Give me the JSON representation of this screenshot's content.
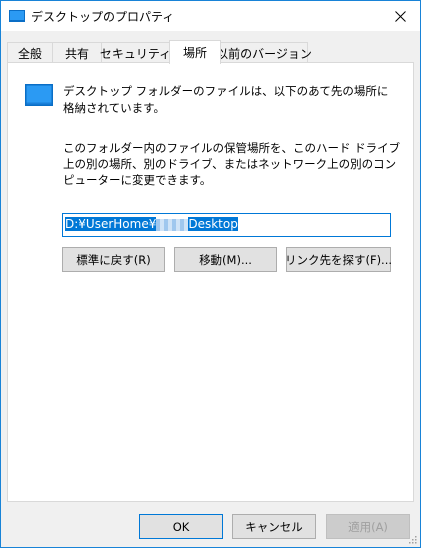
{
  "window": {
    "title": "デスクトップのプロパティ"
  },
  "tabs": [
    {
      "label": "全般",
      "active": false
    },
    {
      "label": "共有",
      "active": false
    },
    {
      "label": "セキュリティ",
      "active": false
    },
    {
      "label": "場所",
      "active": true
    },
    {
      "label": "以前のバージョン",
      "active": false
    }
  ],
  "location": {
    "description1": "デスクトップ フォルダーのファイルは、以下のあて先の場所に格納されています。",
    "description2": "このフォルダー内のファイルの保管場所を、このハード ドライブ上の別の場所、別のドライブ、またはネットワーク上の別のコンピューターに変更できます。",
    "path_prefix": "D:¥UserHome¥",
    "path_suffix": "Desktop",
    "restore_default_label": "標準に戻す(R)",
    "move_label": "移動(M)...",
    "find_target_label": "リンク先を探す(F)..."
  },
  "footer": {
    "ok_label": "OK",
    "cancel_label": "キャンセル",
    "apply_label": "適用(A)"
  },
  "colors": {
    "accent": "#0078d7",
    "border": "#1883d7"
  }
}
